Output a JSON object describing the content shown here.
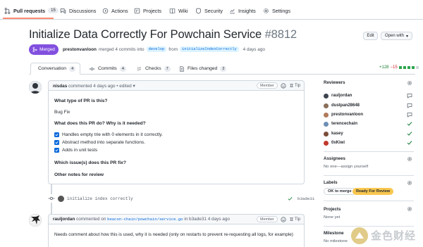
{
  "repo_nav": {
    "tabs": [
      {
        "label": "Pull requests",
        "count": "15",
        "icon": "pull-request-icon"
      },
      {
        "label": "Discussions",
        "icon": "discussions-icon"
      },
      {
        "label": "Actions",
        "icon": "actions-icon"
      },
      {
        "label": "Projects",
        "icon": "projects-icon"
      },
      {
        "label": "Wiki",
        "icon": "wiki-icon"
      },
      {
        "label": "Security",
        "icon": "shield-icon"
      },
      {
        "label": "Insights",
        "icon": "insights-icon"
      },
      {
        "label": "Settings",
        "icon": "gear-icon"
      }
    ]
  },
  "pr": {
    "title": "Initialize Data Correctly For Powchain Service",
    "number": "#8812",
    "edit_label": "Edit",
    "open_with_label": "Open with",
    "status": "Merged",
    "author": "prestonvanloon",
    "merge_text": "merged 4 commits into",
    "base_branch": "develop",
    "from_text": "from",
    "head_branch": "initializeIndexCorrectly",
    "time": "4 days ago"
  },
  "pr_tabs": [
    {
      "label": "Conversation",
      "count": "4",
      "icon": "conversation-icon"
    },
    {
      "label": "Commits",
      "count": "4",
      "icon": "commit-icon"
    },
    {
      "label": "Checks",
      "count": "7",
      "icon": "checks-icon"
    },
    {
      "label": "Files changed",
      "count": "2",
      "icon": "file-diff-icon"
    }
  ],
  "diffstat": {
    "additions": "+128",
    "deletions": "−15"
  },
  "comment1": {
    "author": "nisdas",
    "action": "commented 4 days ago",
    "edited": "• edited",
    "badge": "Member",
    "tip": "Tip",
    "q1": "What type of PR is this?",
    "a1": "Bug Fix",
    "q2": "What does this PR do? Why is it needed?",
    "tasks": [
      "Handles empty trie with 0 elements in it correctly.",
      "Abstract method into separate functions.",
      "Adds in unit tests"
    ],
    "q3": "Which issue(s) does this PR fix?",
    "q4": "Other notes for review"
  },
  "commit": {
    "message": "initialize index correctly",
    "sha": "b3ade31"
  },
  "comment2": {
    "author": "rauljordan",
    "action": "commented on",
    "file": "beacon-chain/powchain/service.go",
    "in_text": "in b3ade31 4 days ago",
    "badge": "Member",
    "tip": "Tip",
    "body": "Needs comment about how this is used, why it is needed (only on restarts to prevent re-requesting all logs, for example)"
  },
  "sidebar": {
    "reviewers_label": "Reviewers",
    "reviewers": [
      {
        "name": "rauljordan",
        "status": "comment-icon",
        "color": "#3d4450"
      },
      {
        "name": "dustpan28648",
        "status": "comment-icon",
        "color": "#8a6d5a"
      },
      {
        "name": "prestonvanloon",
        "status": "comment-icon",
        "color": "#b07a5a"
      },
      {
        "name": "terencechain",
        "status": "check-icon",
        "color": "#6b8fb5"
      },
      {
        "name": "kasey",
        "status": "check-icon",
        "color": "#7a4e3a"
      },
      {
        "name": "0xKiwi",
        "status": "check-icon",
        "color": "#c0392b"
      }
    ],
    "assignees_label": "Assignees",
    "assignees_empty": "No one—assign yourself",
    "labels_label": "Labels",
    "labels": [
      {
        "name": "OK to merge",
        "bg": "#ffffff",
        "fg": "#24292f"
      },
      {
        "name": "Ready For Review",
        "bg": "#f9c74f",
        "fg": "#24292f"
      }
    ],
    "projects_label": "Projects",
    "projects_empty": "None yet",
    "milestone_label": "Milestone",
    "milestone_empty": "No milestone"
  },
  "watermark": {
    "text": "金色财经"
  },
  "colors": {
    "merged": "#8250df",
    "accent": "#0969da",
    "tab_underline": "#fd8c73"
  }
}
